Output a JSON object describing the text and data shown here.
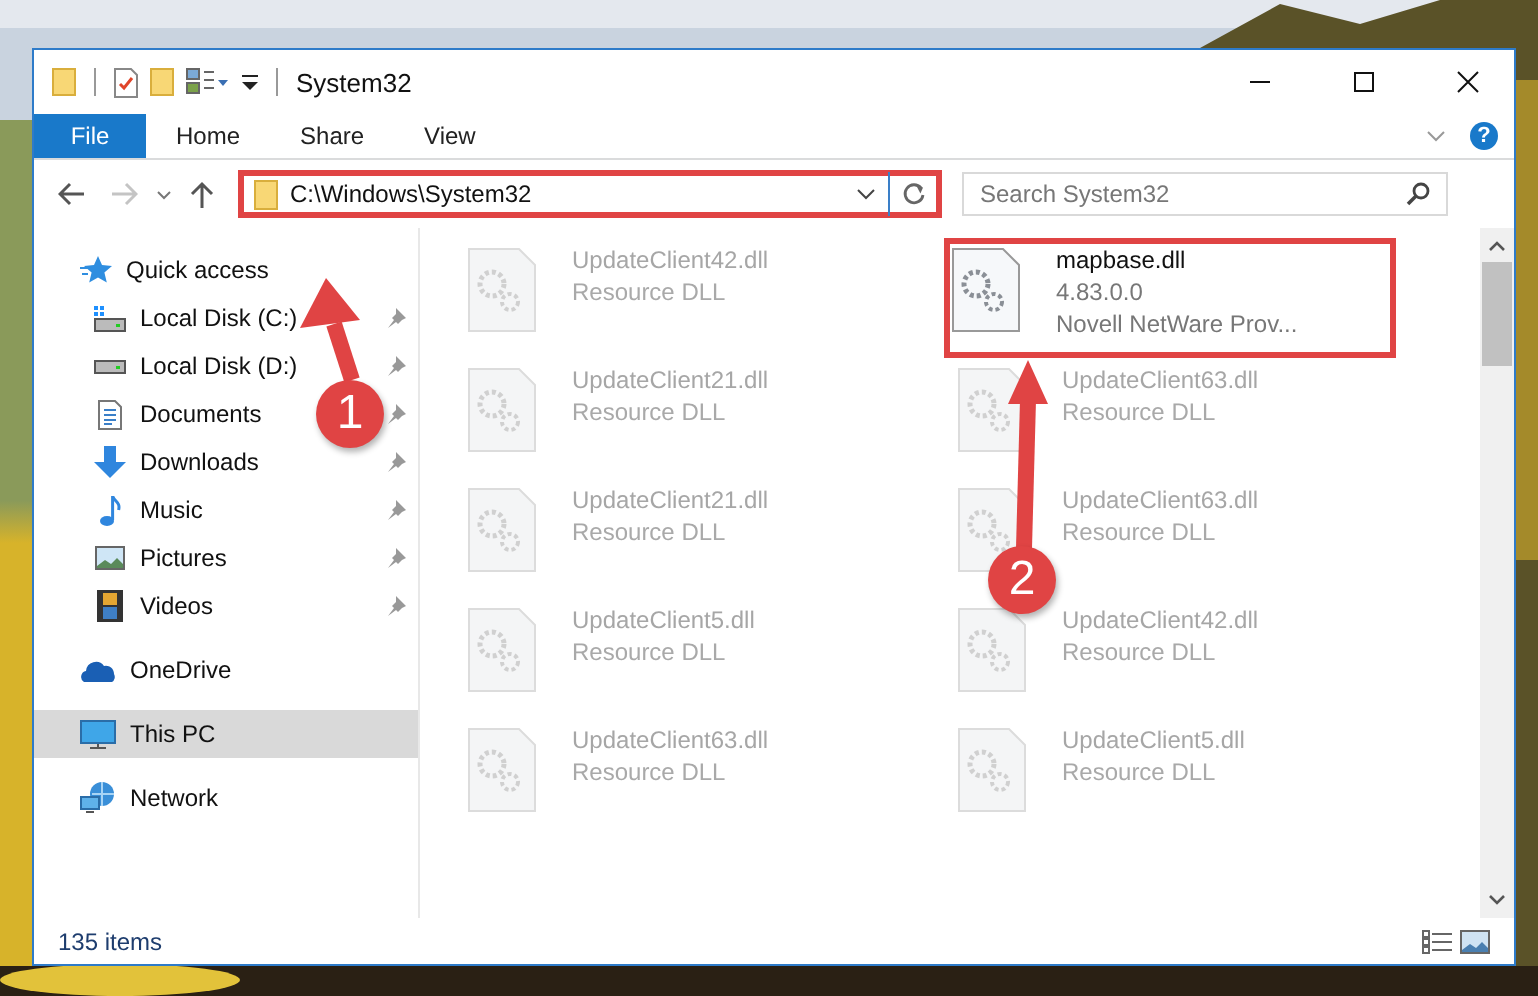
{
  "window": {
    "title": "System32"
  },
  "ribbon_tabs": [
    {
      "label": "File",
      "selected": true
    },
    {
      "label": "Home",
      "selected": false
    },
    {
      "label": "Share",
      "selected": false
    },
    {
      "label": "View",
      "selected": false
    }
  ],
  "help": "?",
  "address": {
    "path": "C:\\Windows\\System32",
    "annotated": true
  },
  "search": {
    "placeholder": "Search System32"
  },
  "sidebar": {
    "items": [
      {
        "label": "Quick access",
        "kind": "quick",
        "selected": false,
        "children": [
          {
            "label": "Local Disk (C:)",
            "kind": "system-drive",
            "pinned": true
          },
          {
            "label": "Local Disk (D:)",
            "kind": "drive",
            "pinned": true
          },
          {
            "label": "Documents",
            "kind": "documents",
            "pinned": true
          },
          {
            "label": "Downloads",
            "kind": "downloads",
            "pinned": true
          },
          {
            "label": "Music",
            "kind": "music",
            "pinned": true
          },
          {
            "label": "Pictures",
            "kind": "pictures",
            "pinned": true
          },
          {
            "label": "Videos",
            "kind": "videos",
            "pinned": true
          }
        ]
      },
      {
        "label": "OneDrive",
        "kind": "onedrive",
        "selected": false
      },
      {
        "label": "This PC",
        "kind": "pc",
        "selected": true
      },
      {
        "label": "Network",
        "kind": "network",
        "selected": false
      }
    ]
  },
  "files": [
    {
      "name": "UpdateClient42.dll",
      "details": [
        "Resource DLL"
      ],
      "dimmed": true,
      "annotated": false
    },
    {
      "name": "mapbase.dll",
      "details": [
        "4.83.0.0",
        "Novell NetWare Prov..."
      ],
      "dimmed": false,
      "annotated": true
    },
    {
      "name": "UpdateClient21.dll",
      "details": [
        "Resource DLL"
      ],
      "dimmed": true,
      "annotated": false
    },
    {
      "name": "UpdateClient63.dll",
      "details": [
        "Resource DLL"
      ],
      "dimmed": true,
      "annotated": false
    },
    {
      "name": "UpdateClient21.dll",
      "details": [
        "Resource DLL"
      ],
      "dimmed": true,
      "annotated": false
    },
    {
      "name": "UpdateClient63.dll",
      "details": [
        "Resource DLL"
      ],
      "dimmed": true,
      "annotated": false
    },
    {
      "name": "UpdateClient5.dll",
      "details": [
        "Resource DLL"
      ],
      "dimmed": true,
      "annotated": false
    },
    {
      "name": "UpdateClient42.dll",
      "details": [
        "Resource DLL"
      ],
      "dimmed": true,
      "annotated": false
    },
    {
      "name": "UpdateClient63.dll",
      "details": [
        "Resource DLL"
      ],
      "dimmed": true,
      "annotated": false
    },
    {
      "name": "UpdateClient5.dll",
      "details": [
        "Resource DLL"
      ],
      "dimmed": true,
      "annotated": false
    }
  ],
  "status_bar": {
    "count": "135 items"
  },
  "annotations": [
    {
      "number": "1"
    },
    {
      "number": "2"
    }
  ]
}
